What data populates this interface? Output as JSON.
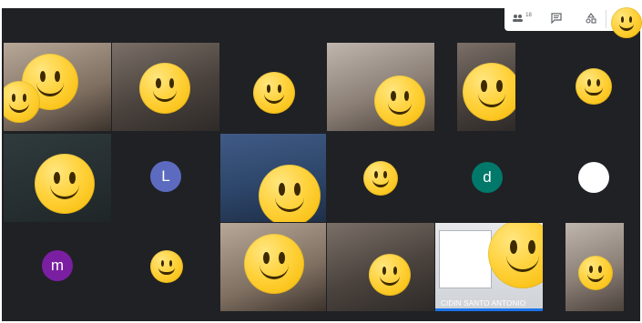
{
  "toolbar": {
    "participants_count": "18",
    "buttons": [
      {
        "name": "participants-button",
        "icon": "people-icon"
      },
      {
        "name": "chat-button",
        "icon": "chat-icon"
      },
      {
        "name": "activities-button",
        "icon": "activities-icon"
      }
    ],
    "self_avatar_icon": "self-view-avatar"
  },
  "participants": [
    {
      "id": "p1",
      "type": "camera"
    },
    {
      "id": "p2",
      "type": "camera"
    },
    {
      "id": "p3",
      "type": "camera"
    },
    {
      "id": "p4",
      "type": "camera"
    },
    {
      "id": "p5",
      "type": "camera"
    },
    {
      "id": "p6",
      "type": "camera"
    },
    {
      "id": "p7",
      "type": "camera"
    },
    {
      "id": "p8",
      "type": "avatar",
      "initial": "L",
      "color": "#5c6bc0"
    },
    {
      "id": "p9",
      "type": "camera"
    },
    {
      "id": "p10",
      "type": "camera"
    },
    {
      "id": "p11",
      "type": "avatar",
      "initial": "d",
      "color": "#00796b"
    },
    {
      "id": "p12",
      "type": "avatar",
      "initial": "",
      "color": "#ffffff"
    },
    {
      "id": "p13",
      "type": "avatar",
      "initial": "m",
      "color": "#7b1fa2"
    },
    {
      "id": "p14",
      "type": "camera"
    },
    {
      "id": "p15",
      "type": "camera"
    },
    {
      "id": "p16",
      "type": "camera"
    },
    {
      "id": "p17",
      "type": "camera",
      "name": "CIDIN SANTO ANTONIO",
      "speaking": true
    },
    {
      "id": "p18",
      "type": "camera"
    }
  ],
  "colors": {
    "background": "#202124",
    "speaking_indicator": "#1a73e8",
    "toolbar_bg": "#ffffff"
  }
}
